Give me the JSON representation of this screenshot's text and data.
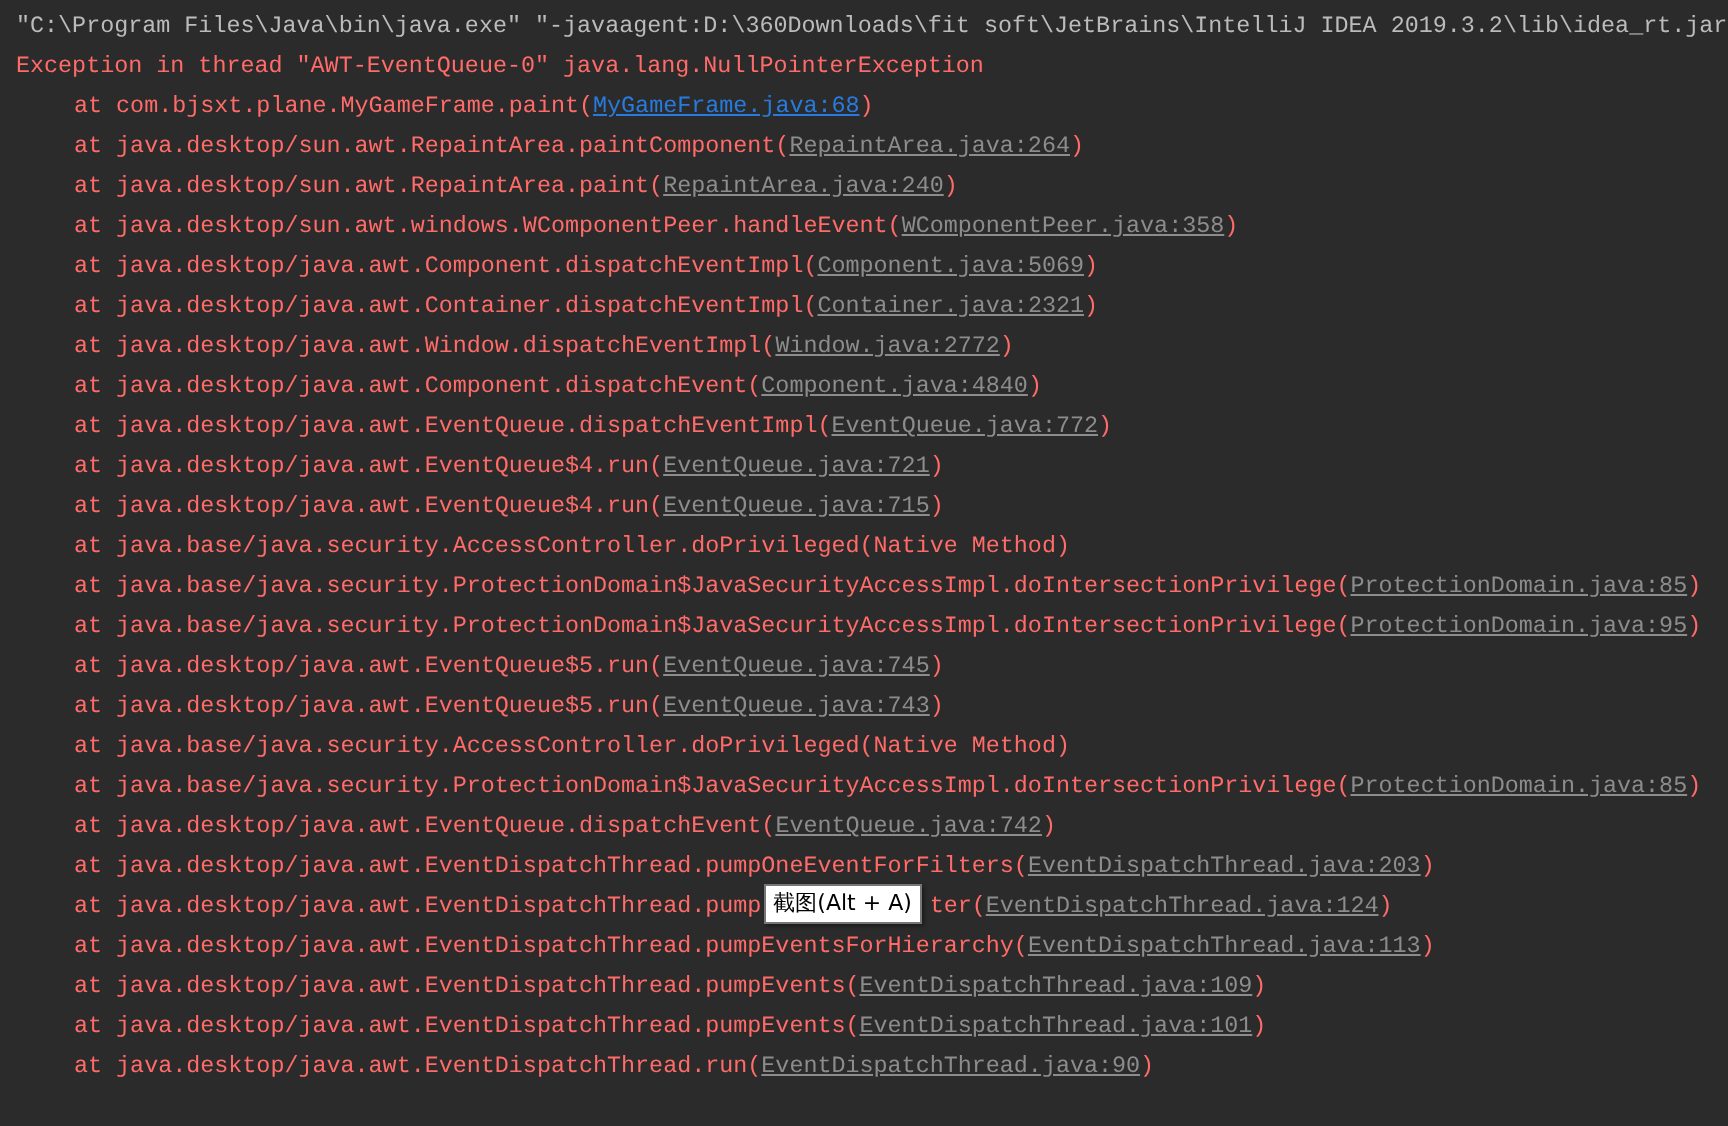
{
  "console": {
    "lines": [
      {
        "kind": "command",
        "text": "\"C:\\Program Files\\Java\\bin\\java.exe\" \"-javaagent:D:\\360Downloads\\fit soft\\JetBrains\\IntelliJ IDEA 2019.3.2\\lib\\idea_rt.jar"
      },
      {
        "kind": "error",
        "text": "Exception in thread \"AWT-EventQueue-0\" java.lang.NullPointerException"
      },
      {
        "kind": "frame",
        "text": "at com.bjsxt.plane.MyGameFrame.paint(",
        "link": "MyGameFrame.java:68",
        "link_active": true,
        "tail": ")"
      },
      {
        "kind": "frame",
        "text": "at java.desktop/sun.awt.RepaintArea.paintComponent(",
        "link": "RepaintArea.java:264",
        "link_active": false,
        "tail": ")"
      },
      {
        "kind": "frame",
        "text": "at java.desktop/sun.awt.RepaintArea.paint(",
        "link": "RepaintArea.java:240",
        "link_active": false,
        "tail": ")"
      },
      {
        "kind": "frame",
        "text": "at java.desktop/sun.awt.windows.WComponentPeer.handleEvent(",
        "link": "WComponentPeer.java:358",
        "link_active": false,
        "tail": ")"
      },
      {
        "kind": "frame",
        "text": "at java.desktop/java.awt.Component.dispatchEventImpl(",
        "link": "Component.java:5069",
        "link_active": false,
        "tail": ")"
      },
      {
        "kind": "frame",
        "text": "at java.desktop/java.awt.Container.dispatchEventImpl(",
        "link": "Container.java:2321",
        "link_active": false,
        "tail": ")"
      },
      {
        "kind": "frame",
        "text": "at java.desktop/java.awt.Window.dispatchEventImpl(",
        "link": "Window.java:2772",
        "link_active": false,
        "tail": ")"
      },
      {
        "kind": "frame",
        "text": "at java.desktop/java.awt.Component.dispatchEvent(",
        "link": "Component.java:4840",
        "link_active": false,
        "tail": ")"
      },
      {
        "kind": "frame",
        "text": "at java.desktop/java.awt.EventQueue.dispatchEventImpl(",
        "link": "EventQueue.java:772",
        "link_active": false,
        "tail": ")"
      },
      {
        "kind": "frame",
        "text": "at java.desktop/java.awt.EventQueue$4.run(",
        "link": "EventQueue.java:721",
        "link_active": false,
        "tail": ")"
      },
      {
        "kind": "frame",
        "text": "at java.desktop/java.awt.EventQueue$4.run(",
        "link": "EventQueue.java:715",
        "link_active": false,
        "tail": ")"
      },
      {
        "kind": "native",
        "text": "at java.base/java.security.AccessController.doPrivileged(Native Method)"
      },
      {
        "kind": "frame",
        "text": "at java.base/java.security.ProtectionDomain$JavaSecurityAccessImpl.doIntersectionPrivilege(",
        "link": "ProtectionDomain.java:85",
        "link_active": false,
        "tail": ")"
      },
      {
        "kind": "frame",
        "text": "at java.base/java.security.ProtectionDomain$JavaSecurityAccessImpl.doIntersectionPrivilege(",
        "link": "ProtectionDomain.java:95",
        "link_active": false,
        "tail": ")"
      },
      {
        "kind": "frame",
        "text": "at java.desktop/java.awt.EventQueue$5.run(",
        "link": "EventQueue.java:745",
        "link_active": false,
        "tail": ")"
      },
      {
        "kind": "frame",
        "text": "at java.desktop/java.awt.EventQueue$5.run(",
        "link": "EventQueue.java:743",
        "link_active": false,
        "tail": ")"
      },
      {
        "kind": "native",
        "text": "at java.base/java.security.AccessController.doPrivileged(Native Method)"
      },
      {
        "kind": "frame",
        "text": "at java.base/java.security.ProtectionDomain$JavaSecurityAccessImpl.doIntersectionPrivilege(",
        "link": "ProtectionDomain.java:85",
        "link_active": false,
        "tail": ")"
      },
      {
        "kind": "frame",
        "text": "at java.desktop/java.awt.EventQueue.dispatchEvent(",
        "link": "EventQueue.java:742",
        "link_active": false,
        "tail": ")"
      },
      {
        "kind": "frame",
        "text": "at java.desktop/java.awt.EventDispatchThread.pumpOneEventForFilters(",
        "link": "EventDispatchThread.java:203",
        "link_active": false,
        "tail": ")"
      },
      {
        "kind": "covered",
        "text": "at java.desktop/java.awt.EventDispatchThread.pump",
        "after": "ter(",
        "link": "EventDispatchThread.java:124",
        "link_active": false,
        "tail": ")",
        "tooltip": "截图(Alt + A)"
      },
      {
        "kind": "frame",
        "text": "at java.desktop/java.awt.EventDispatchThread.pumpEventsForHierarchy(",
        "link": "EventDispatchThread.java:113",
        "link_active": false,
        "tail": ")"
      },
      {
        "kind": "frame",
        "text": "at java.desktop/java.awt.EventDispatchThread.pumpEvents(",
        "link": "EventDispatchThread.java:109",
        "link_active": false,
        "tail": ")"
      },
      {
        "kind": "frame",
        "text": "at java.desktop/java.awt.EventDispatchThread.pumpEvents(",
        "link": "EventDispatchThread.java:101",
        "link_active": false,
        "tail": ")"
      },
      {
        "kind": "frame",
        "text": "at java.desktop/java.awt.EventDispatchThread.run(",
        "link": "EventDispatchThread.java:90",
        "link_active": false,
        "tail": ")"
      }
    ]
  }
}
